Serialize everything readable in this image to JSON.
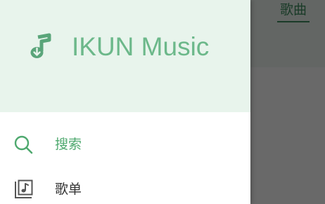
{
  "app": {
    "name": "IKUN Music",
    "brand_color": "#6cb88a",
    "accent_color": "#4fa96f",
    "header_bg": "#e8f4ec"
  },
  "main": {
    "tabs": [
      {
        "label": "歌曲",
        "selected": true
      }
    ]
  },
  "drawer": {
    "logo_icon": "music-note-download-icon",
    "menu": [
      {
        "label": "搜索",
        "icon": "search-icon",
        "active": true
      },
      {
        "label": "歌单",
        "icon": "playlist-icon",
        "active": false
      }
    ]
  }
}
